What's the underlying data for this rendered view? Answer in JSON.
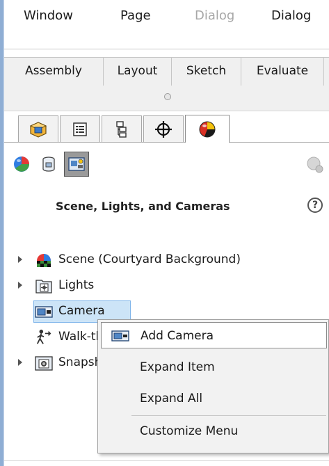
{
  "menubar": {
    "items": [
      {
        "label": "Window",
        "dim": false
      },
      {
        "label": "Page",
        "dim": false
      },
      {
        "label": "Dialog",
        "dim": true
      },
      {
        "label": "Dialog",
        "dim": false
      }
    ]
  },
  "command_tabs": [
    "Assembly",
    "Layout",
    "Sketch",
    "Evaluate"
  ],
  "manager_tabs": [
    {
      "icon": "part-icon"
    },
    {
      "icon": "property-manager-icon"
    },
    {
      "icon": "configuration-manager-icon"
    },
    {
      "icon": "dimxpert-icon"
    },
    {
      "icon": "display-manager-icon",
      "active": true
    }
  ],
  "display_icons": [
    "appearances-icon",
    "decals-icon",
    "scene-lights-cameras-icon",
    "render-tools-icon"
  ],
  "panel": {
    "title": "Scene, Lights, and Cameras",
    "help": "?"
  },
  "tree": [
    {
      "label": "Scene (Courtyard Background)",
      "icon": "scene-icon",
      "expandable": true
    },
    {
      "label": "Lights",
      "icon": "lights-icon",
      "expandable": true
    },
    {
      "label": "Camera",
      "icon": "camera-icon",
      "expandable": false,
      "selected": true
    },
    {
      "label": "Walk-through",
      "icon": "walkthrough-icon",
      "expandable": false
    },
    {
      "label": "Snapshots",
      "icon": "snapshot-icon",
      "expandable": true
    }
  ],
  "context_menu": {
    "items": [
      {
        "label": "Add Camera",
        "icon": "camera-icon",
        "highlighted": true
      },
      {
        "label": "Expand Item"
      },
      {
        "label": "Expand All"
      },
      {
        "label": "Customize Menu"
      }
    ]
  },
  "colors": {
    "selection": "#cce4f7",
    "selection_border": "#7eb4ea",
    "tab_background": "#f0f0f0",
    "window_edge": "#8faed4"
  }
}
